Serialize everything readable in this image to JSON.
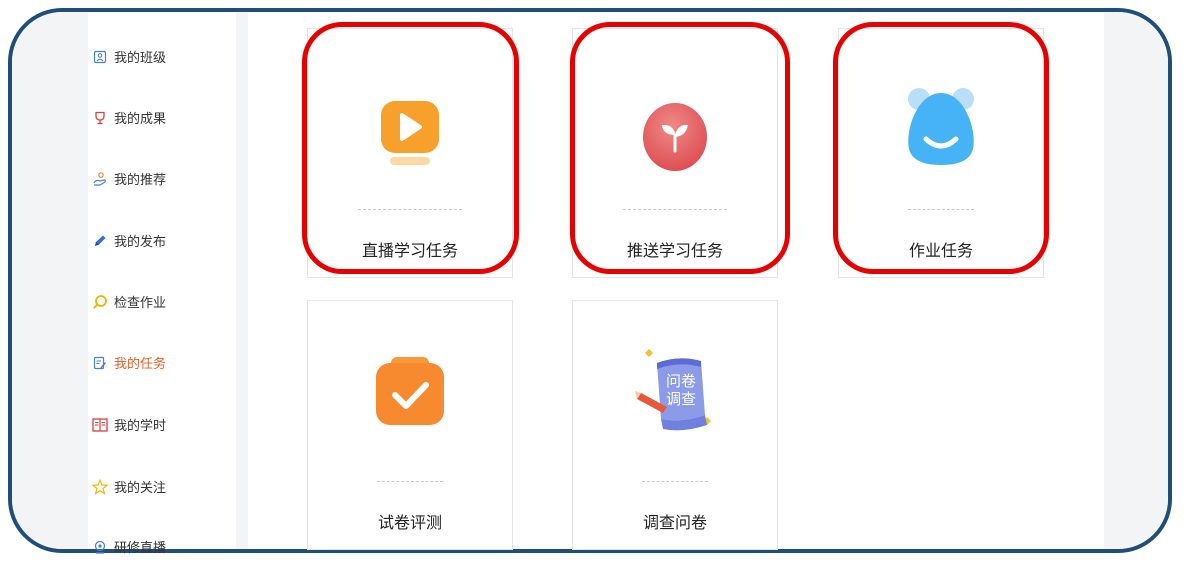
{
  "sidebar": {
    "items": [
      {
        "label": "我的班级",
        "icon": "class-icon",
        "active": false
      },
      {
        "label": "我的成果",
        "icon": "trophy-icon",
        "active": false
      },
      {
        "label": "我的推荐",
        "icon": "recommend-icon",
        "active": false
      },
      {
        "label": "我的发布",
        "icon": "publish-icon",
        "active": false
      },
      {
        "label": "检查作业",
        "icon": "search-icon",
        "active": false
      },
      {
        "label": "我的任务",
        "icon": "task-icon",
        "active": true
      },
      {
        "label": "我的学时",
        "icon": "book-icon",
        "active": false
      },
      {
        "label": "我的关注",
        "icon": "star-icon",
        "active": false
      },
      {
        "label": "研修直播",
        "icon": "live-icon",
        "active": false
      }
    ]
  },
  "cards": [
    {
      "label": "直播学习任务",
      "icon": "live-play-icon",
      "highlighted": true
    },
    {
      "label": "推送学习任务",
      "icon": "sprout-icon",
      "highlighted": true
    },
    {
      "label": "作业任务",
      "icon": "smile-icon",
      "highlighted": true
    },
    {
      "label": "试卷评测",
      "icon": "checkmark-icon",
      "highlighted": false
    },
    {
      "label": "调查问卷",
      "icon": "survey-scroll-icon",
      "highlighted": false
    }
  ],
  "survey_icon_text": [
    "问卷",
    "调查"
  ],
  "colors": {
    "active": "#e2622a",
    "highlight": "#e60000",
    "frame": "#1f4e79",
    "orange": "#f7a02b",
    "pink": "#e5545a",
    "blue": "#3aa8f0"
  }
}
